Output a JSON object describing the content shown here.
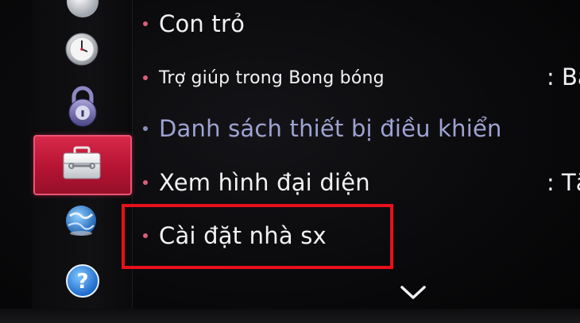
{
  "sidebar": {
    "icons": [
      {
        "name": "picture-icon"
      },
      {
        "name": "clock-icon"
      },
      {
        "name": "lock-icon"
      },
      {
        "name": "toolbox-icon",
        "selected": true
      },
      {
        "name": "network-globe-icon"
      },
      {
        "name": "help-icon",
        "glyph": "?"
      }
    ],
    "selected_color": "#c41a3a"
  },
  "menu": {
    "items": [
      {
        "label": "Con trỏ",
        "value": ""
      },
      {
        "label": "Trợ giúp trong Bong bóng",
        "value": ": Bật"
      },
      {
        "label": "Danh sách thiết bị điều khiển",
        "value": ""
      },
      {
        "label": "Xem hình đại diện",
        "value": ": Tắt"
      },
      {
        "label": "Cài đặt nhà sx",
        "value": ""
      }
    ],
    "highlight_color": "#e8101a",
    "scroll_down_icon": "chevron-down-icon"
  }
}
